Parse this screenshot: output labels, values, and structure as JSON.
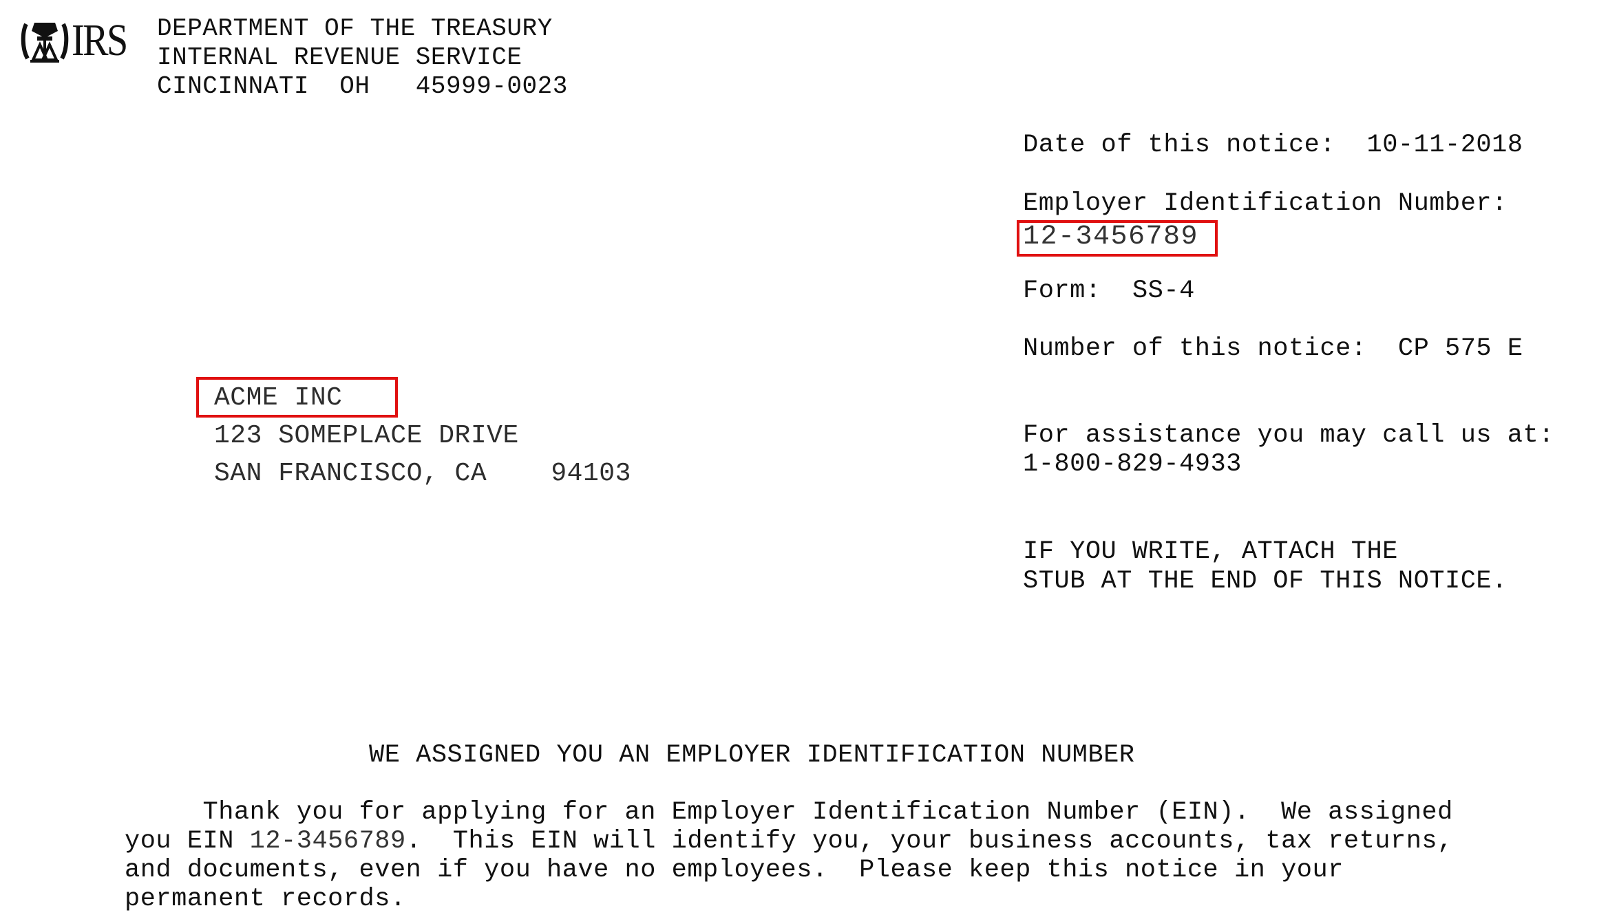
{
  "letterhead": {
    "logo_icon": "irs-eagle-icon",
    "logo_text": "IRS",
    "lines": [
      "DEPARTMENT OF THE TREASURY",
      "INTERNAL REVENUE SERVICE",
      "CINCINNATI  OH   45999-0023"
    ]
  },
  "notice_info": {
    "date_label": "Date of this notice:",
    "date_value": "10-11-2018",
    "ein_label": "Employer Identification Number:",
    "ein_value": "12-3456789",
    "form_label": "Form:",
    "form_value": "SS-4",
    "notice_number_label": "Number of this notice:",
    "notice_number_value": "CP 575 E",
    "assistance_label": "For assistance you may call us at:",
    "assistance_phone": "1-800-829-4933",
    "write_line_1": "IF YOU WRITE, ATTACH THE",
    "write_line_2": "STUB AT THE END OF THIS NOTICE."
  },
  "recipient": {
    "name": "ACME INC",
    "street": "123 SOMEPLACE DRIVE",
    "city_state_zip": "SAN FRANCISCO, CA    94103"
  },
  "highlight_color": "#e01010",
  "body": {
    "title": "WE ASSIGNED YOU AN EMPLOYER IDENTIFICATION NUMBER",
    "para_line_1": "     Thank you for applying for an Employer Identification Number (EIN).  We assigned",
    "para_line_2_pre": "you EIN ",
    "para_line_2_ein": "12-3456789",
    "para_line_2_post": ".  This EIN will identify you, your business accounts, tax returns,",
    "para_line_3": "and documents, even if you have no employees.  Please keep this notice in your",
    "para_line_4": "permanent records."
  }
}
